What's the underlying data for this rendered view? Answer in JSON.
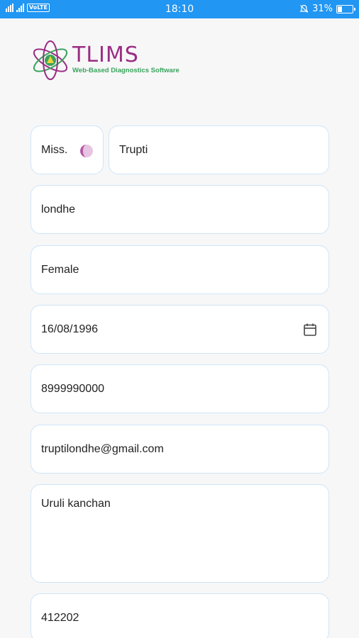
{
  "status_bar": {
    "volte": "VoLTE",
    "time": "18:10",
    "battery_text": "31%",
    "battery_level": 0.31
  },
  "logo": {
    "brand": "TLIMS",
    "tagline": "Web-Based Diagnostics Software"
  },
  "form": {
    "title": "Miss.",
    "first_name": "Trupti",
    "last_name": "londhe",
    "gender": "Female",
    "dob": "16/08/1996",
    "phone": "8999990000",
    "email": "truptilondhe@gmail.com",
    "address": "Uruli kanchan",
    "pincode": "412202"
  },
  "colors": {
    "status_bar": "#2196f3",
    "brand": "#9b2d83",
    "tagline": "#3aa35b",
    "field_border": "#cfe5f7"
  }
}
